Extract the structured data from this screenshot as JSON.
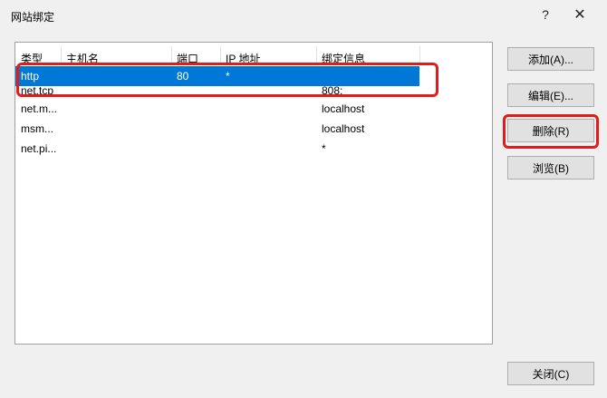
{
  "window": {
    "title": "网站绑定",
    "help_glyph": "?",
    "close_glyph": "✕"
  },
  "list": {
    "columns": [
      "类型",
      "主机名",
      "端口",
      "IP 地址",
      "绑定信息"
    ],
    "rows": [
      {
        "type": "http",
        "host": "",
        "port": "80",
        "ip": "*",
        "info": ""
      },
      {
        "type": "net.tcp",
        "host": "",
        "port": "",
        "ip": "",
        "info": "808:"
      },
      {
        "type": "net.m...",
        "host": "",
        "port": "",
        "ip": "",
        "info": "localhost"
      },
      {
        "type": "msm...",
        "host": "",
        "port": "",
        "ip": "",
        "info": "localhost"
      },
      {
        "type": "net.pi...",
        "host": "",
        "port": "",
        "ip": "",
        "info": "*"
      }
    ],
    "selected_index": 0
  },
  "buttons": {
    "add": "添加(A)...",
    "edit": "编辑(E)...",
    "delete": "删除(R)",
    "browse": "浏览(B)",
    "close": "关闭(C)"
  },
  "colors": {
    "selection": "#0078d7",
    "highlight": "#e01c1c"
  }
}
